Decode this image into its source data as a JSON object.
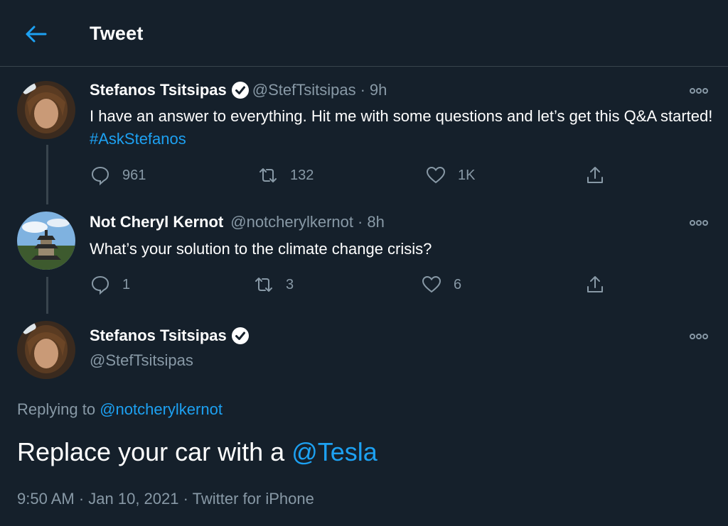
{
  "header": {
    "title": "Tweet",
    "back_icon": "arrow-left-icon"
  },
  "colors": {
    "background": "#15202b",
    "accent": "#1da1f2",
    "muted": "#8899a6",
    "divider": "#38444d"
  },
  "tweets": [
    {
      "name": "Stefanos Tsitsipas",
      "verified": true,
      "handle": "@StefTsitsipas",
      "sep": "·",
      "time": "9h",
      "text": "I have an answer to everything. Hit me with some questions and let’s get this Q&A started!",
      "hashtag": "#AskStefanos",
      "replies": "961",
      "retweets": "132",
      "likes": "1K"
    },
    {
      "name": "Not Cheryl Kernot",
      "verified": false,
      "handle": "@notcherylkernot",
      "sep": "·",
      "time": "8h",
      "text": "What’s your solution to the climate change crisis?",
      "replies": "1",
      "retweets": "3",
      "likes": "6"
    }
  ],
  "main_tweet": {
    "name": "Stefanos Tsitsipas",
    "verified": true,
    "handle": "@StefTsitsipas",
    "replying_prefix": "Replying to",
    "replying_to": "@notcherylkernot",
    "text": "Replace your car with a",
    "mention": "@Tesla",
    "timestamp": "9:50 AM · Jan 10, 2021 · Twitter for iPhone"
  }
}
